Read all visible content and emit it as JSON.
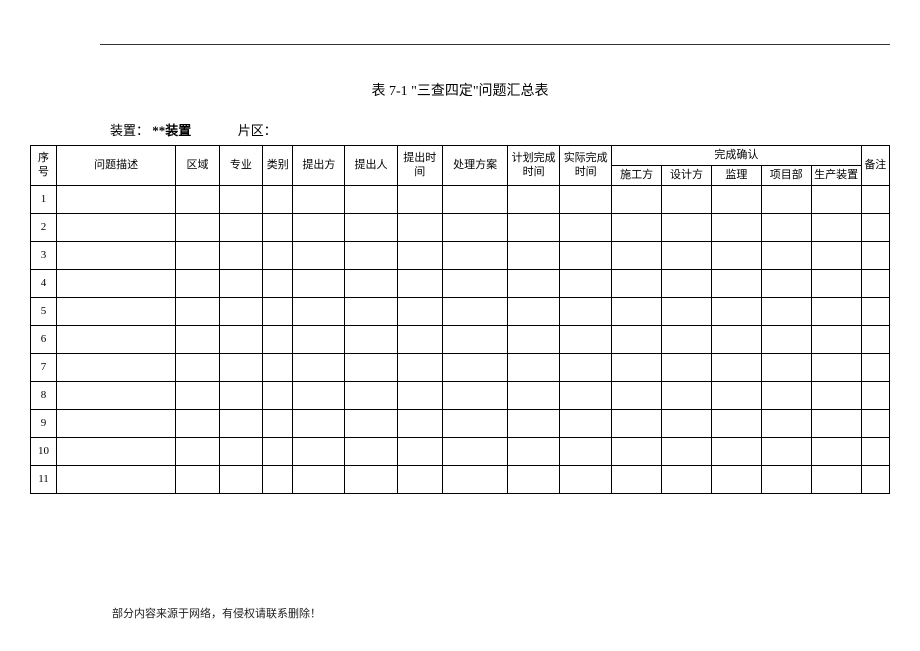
{
  "title": "表 7-1   \"三查四定\"问题汇总表",
  "meta": {
    "device_label": "装置：",
    "device_value": "**装置",
    "zone_label": "片区：",
    "zone_value": ""
  },
  "headers": {
    "seq": "序号",
    "desc": "问题描述",
    "area": "区域",
    "major": "专业",
    "category": "类别",
    "proposer": "提出方",
    "person": "提出人",
    "time": "提出时间",
    "plan": "处理方案",
    "ptime": "计划完成时间",
    "atime": "实际完成时间",
    "confirm_group": "完成确认",
    "confirm": {
      "construction": "施工方",
      "design": "设计方",
      "supervision": "监理",
      "project": "项目部",
      "production": "生产装置"
    },
    "note": "备注"
  },
  "rows": [
    {
      "seq": "1"
    },
    {
      "seq": "2"
    },
    {
      "seq": "3"
    },
    {
      "seq": "4"
    },
    {
      "seq": "5"
    },
    {
      "seq": "6"
    },
    {
      "seq": "7"
    },
    {
      "seq": "8"
    },
    {
      "seq": "9"
    },
    {
      "seq": "10"
    },
    {
      "seq": "11"
    }
  ],
  "footer": "部分内容来源于网络，有侵权请联系删除！"
}
